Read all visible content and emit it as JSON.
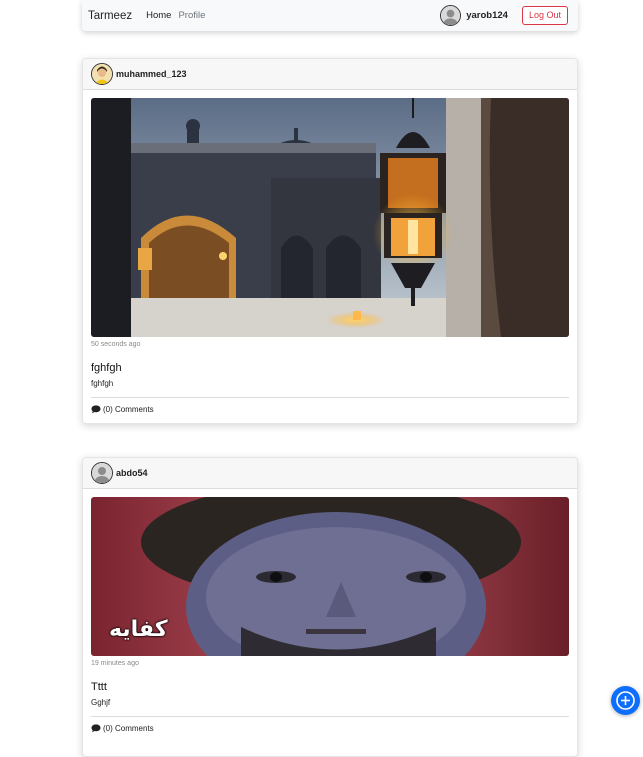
{
  "navbar": {
    "brand": "Tarmeez",
    "links": [
      "Home",
      "Profile"
    ],
    "username": "yarob124",
    "logout_label": "Log Out"
  },
  "posts": [
    {
      "username": "muhammed_123",
      "time": "50 seconds ago",
      "title": "fghfgh",
      "body": "fghfgh",
      "comments": "(0) Comments"
    },
    {
      "username": "abdo54",
      "time": "19 minutes ago",
      "title": "Tttt",
      "body": "Gghjf",
      "comments": "(0) Comments",
      "image_caption": "كفايه"
    }
  ],
  "colors": {
    "accent": "#0d6efd",
    "danger": "#dc3545",
    "navbar_bg": "#f8f9fa"
  },
  "icons": {
    "comment": "speech-bubble",
    "fab": "plus-circle"
  }
}
